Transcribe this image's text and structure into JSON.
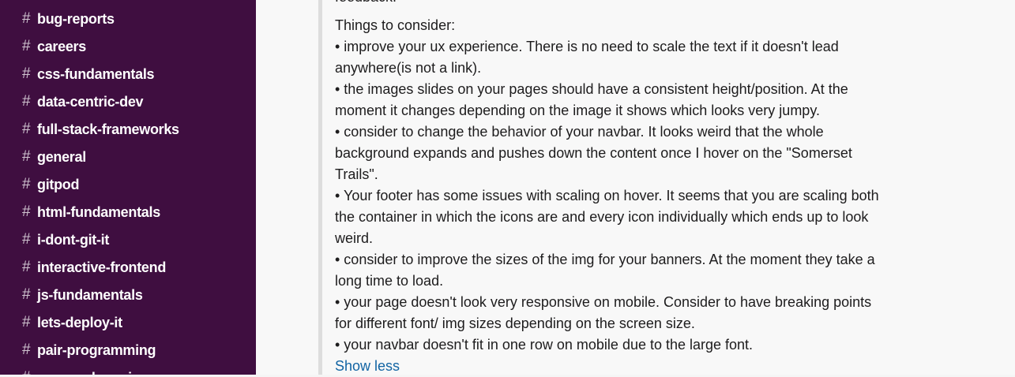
{
  "sidebar": {
    "channels": [
      {
        "hash": "#",
        "name": "bug-reports"
      },
      {
        "hash": "#",
        "name": "careers"
      },
      {
        "hash": "#",
        "name": "css-fundamentals"
      },
      {
        "hash": "#",
        "name": "data-centric-dev"
      },
      {
        "hash": "#",
        "name": "full-stack-frameworks"
      },
      {
        "hash": "#",
        "name": "general"
      },
      {
        "hash": "#",
        "name": "gitpod"
      },
      {
        "hash": "#",
        "name": "html-fundamentals"
      },
      {
        "hash": "#",
        "name": "i-dont-git-it"
      },
      {
        "hash": "#",
        "name": "interactive-frontend"
      },
      {
        "hash": "#",
        "name": "js-fundamentals"
      },
      {
        "hash": "#",
        "name": "lets-deploy-it"
      },
      {
        "hash": "#",
        "name": "pair-programming"
      },
      {
        "hash": "#",
        "name": "peer-code-review"
      }
    ]
  },
  "message": {
    "cut_top_text": "feedback.",
    "lines": [
      "Things to consider:",
      "• improve your ux experience. There is no need to scale the text if it doesn't lead",
      "anywhere(is not a link).",
      "• the images slides on your pages should have a consistent height/position. At the",
      "moment it changes depending on the image it shows which looks very jumpy.",
      "• consider to change the behavior of your navbar. It looks weird that the whole",
      "background expands and pushes down the content once I hover on the \"Somerset",
      "Trails\".",
      "• Your footer has some issues with scaling on hover. It seems that you are scaling both",
      "the container in which the icons are and every icon individually which ends up to look",
      "weird.",
      "• consider to improve the sizes of the img for your banners. At the moment they take a",
      "long time to load.",
      "• your page doesn't look very responsive on mobile. Consider to have breaking points",
      "for different font/ img sizes depending on the screen size.",
      "• your navbar doesn't fit in one row on mobile due to the large font."
    ],
    "show_less": "Show less"
  }
}
